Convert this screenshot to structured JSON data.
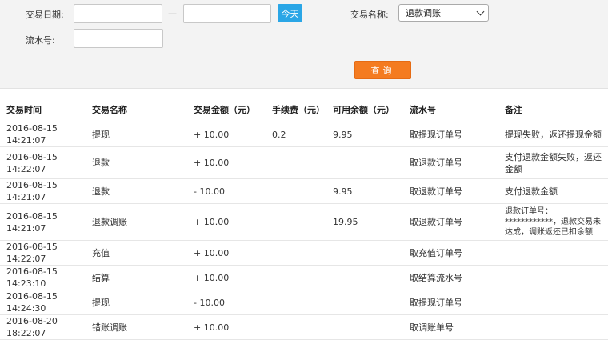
{
  "filter": {
    "date_label": "交易日期:",
    "date_start_value": "",
    "date_end_value": "",
    "date_separator": "—",
    "today_button": "今天",
    "type_label": "交易名称:",
    "type_selected": "退款调账",
    "serial_label": "流水号:",
    "serial_value": "",
    "query_button": "查询"
  },
  "table": {
    "headers": [
      "交易时间",
      "交易名称",
      "交易金额（元）",
      "手续费（元）",
      "可用余额（元）",
      "流水号",
      "备注"
    ],
    "rows": [
      [
        "2016-08-15 14:21:07",
        "提现",
        "+ 10.00",
        "0.2",
        "9.95",
        "取提现订单号",
        "提现失败，返还提现金额"
      ],
      [
        "2016-08-15 14:22:07",
        "退款",
        "+ 10.00",
        "",
        "",
        "取退款订单号",
        "支付退款金额失败，返还金额"
      ],
      [
        "2016-08-15 14:21:07",
        "退款",
        "- 10.00",
        "",
        "9.95",
        "取退款订单号",
        "支付退款金额"
      ],
      [
        "2016-08-15 14:21:07",
        "退款调账",
        "+ 10.00",
        "",
        "19.95",
        "取退款订单号",
        "退款订单号：************，退款交易未达成，调账返还已扣余额"
      ],
      [
        "2016-08-15 14:22:07",
        "充值",
        "+ 10.00",
        "",
        "",
        "取充值订单号",
        ""
      ],
      [
        "2016-08-15 14:23:10",
        "结算",
        "+ 10.00",
        "",
        "",
        "取结算流水号",
        ""
      ],
      [
        "2016-08-15 14:24:30",
        "提现",
        "- 10.00",
        "",
        "",
        "取提现订单号",
        ""
      ],
      [
        "2016-08-20 18:22:07",
        "错账调账",
        "+ 10.00",
        "",
        "",
        "取调账单号",
        ""
      ]
    ]
  },
  "colors": {
    "today_button": "#2aa6e6",
    "query_button": "#f47b20",
    "filter_bg": "#f3f3f3"
  }
}
